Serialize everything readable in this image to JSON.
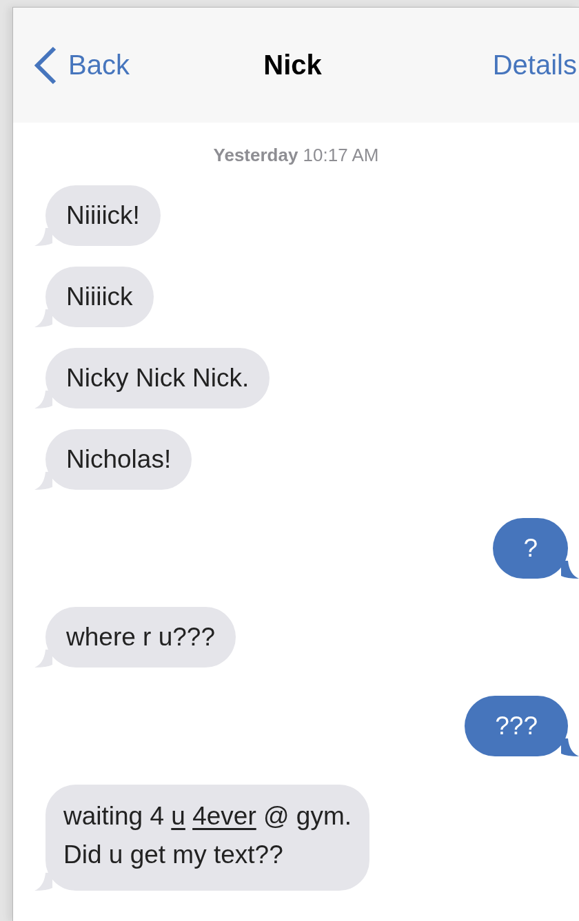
{
  "nav": {
    "back": "Back",
    "title": "Nick",
    "details": "Details"
  },
  "timestamp": "**Yesterday** 10:17 AM",
  "messages": [
    {
      "kind": "received",
      "lines": [
        [
          {
            "text": "Niiiick!",
            "kind": "text"
          }
        ]
      ]
    },
    {
      "kind": "received",
      "lines": [
        [
          {
            "text": "Niiiick",
            "kind": "text"
          }
        ]
      ]
    },
    {
      "kind": "received",
      "lines": [
        [
          {
            "text": "Nicky Nick Nick.",
            "kind": "text"
          }
        ]
      ]
    },
    {
      "kind": "received",
      "lines": [
        [
          {
            "text": "Nicholas!",
            "kind": "text"
          }
        ]
      ]
    },
    {
      "kind": "sent",
      "lines": [
        [
          {
            "text": "?",
            "kind": "text"
          }
        ]
      ]
    },
    {
      "kind": "received",
      "lines": [
        [
          {
            "text": "where r u???",
            "kind": "text"
          }
        ]
      ]
    },
    {
      "kind": "sent",
      "lines": [
        [
          {
            "text": "???",
            "kind": "text"
          }
        ]
      ]
    },
    {
      "kind": "received",
      "lines": [
        [
          {
            "text": "waiting 4",
            "kind": "text"
          },
          {
            "text": "u",
            "kind": "link"
          },
          {
            "text": "4ever",
            "kind": "link"
          },
          {
            "text": "@ gym.",
            "kind": "text"
          }
        ],
        [
          {
            "text": "Did u get my text??",
            "kind": "text"
          }
        ]
      ]
    }
  ]
}
